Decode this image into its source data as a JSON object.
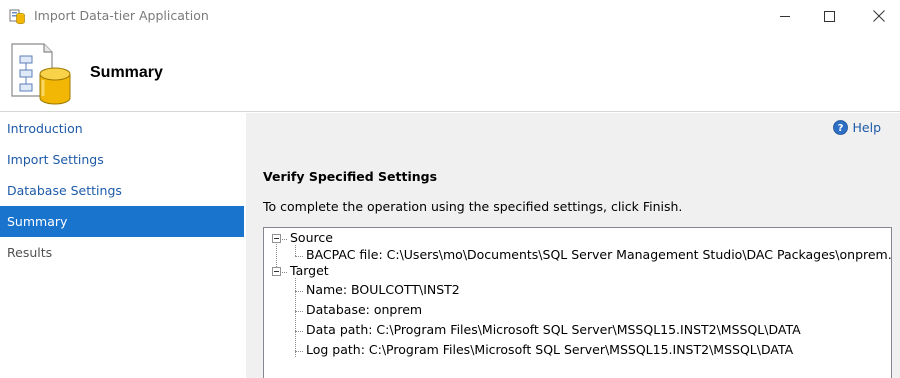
{
  "window": {
    "title": "Import Data-tier Application",
    "controls": [
      "minimize-icon",
      "maximize-icon",
      "close-icon"
    ]
  },
  "header": {
    "title": "Summary",
    "icon": "database-wizard-icon"
  },
  "sidebar": {
    "items": [
      {
        "label": "Introduction",
        "state": "link"
      },
      {
        "label": "Import Settings",
        "state": "link"
      },
      {
        "label": "Database Settings",
        "state": "link"
      },
      {
        "label": "Summary",
        "state": "active"
      },
      {
        "label": "Results",
        "state": "disabled"
      }
    ]
  },
  "main": {
    "help_label": "Help",
    "heading": "Verify Specified Settings",
    "instructions": "To complete the operation using the specified settings, click Finish.",
    "tree": {
      "source": {
        "label": "Source",
        "children": [
          "BACPAC file: C:\\Users\\mo\\Documents\\SQL Server Management Studio\\DAC Packages\\onprem.bacpac"
        ]
      },
      "target": {
        "label": "Target",
        "children": [
          "Name: BOULCOTT\\INST2",
          "Database: onprem",
          "Data path: C:\\Program Files\\Microsoft SQL Server\\MSSQL15.INST2\\MSSQL\\DATA",
          "Log path: C:\\Program Files\\Microsoft SQL Server\\MSSQL15.INST2\\MSSQL\\DATA"
        ]
      }
    }
  },
  "colors": {
    "accent": "#1874cd",
    "link": "#1e5aa8",
    "panel_bg": "#f0f0f0"
  }
}
